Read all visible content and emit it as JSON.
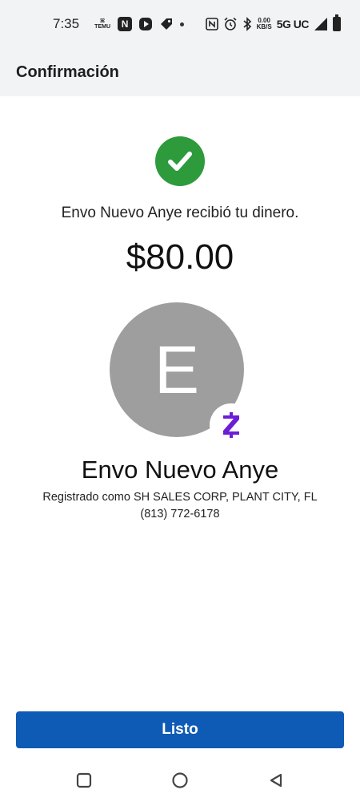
{
  "status_bar": {
    "time": "7:35",
    "temu_text": "TEMU",
    "speed_value": "0.00",
    "speed_unit": "KB/S",
    "network": "5G UC",
    "icons": [
      "temu-icon",
      "news-icon",
      "play-icon",
      "tag-icon",
      "dot-icon",
      "nfc-icon",
      "alarm-icon",
      "bluetooth-icon",
      "signal-icon",
      "battery-icon"
    ]
  },
  "header": {
    "title": "Confirmación"
  },
  "confirmation": {
    "status_icon": "check-circle-icon",
    "status_color": "#2d9b3b",
    "message": "Envo Nuevo Anye recibió tu dinero.",
    "amount": "$80.00"
  },
  "recipient": {
    "avatar_letter": "E",
    "avatar_color": "#9e9e9e",
    "badge_icon": "zelle-icon",
    "badge_color": "#6d1ed4",
    "name": "Envo Nuevo Anye",
    "registered_as": "Registrado como SH SALES CORP, PLANT CITY, FL",
    "phone": "(813) 772-6178"
  },
  "actions": {
    "done_label": "Listo",
    "done_color": "#0e5bb5"
  },
  "nav_bar": {
    "icons": [
      "recents-icon",
      "home-icon",
      "back-icon"
    ]
  }
}
